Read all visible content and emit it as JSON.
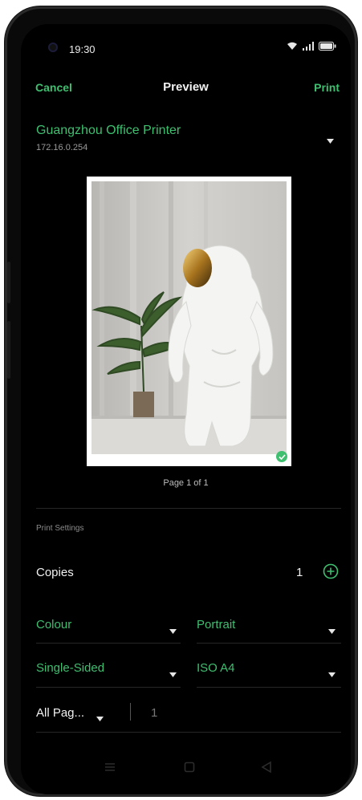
{
  "status_bar": {
    "time": "19:30"
  },
  "header": {
    "cancel_label": "Cancel",
    "title": "Preview",
    "print_label": "Print"
  },
  "printer": {
    "name": "Guangzhou Office Printer",
    "ip": "172.16.0.254"
  },
  "preview": {
    "page_label": "Page 1 of 1"
  },
  "settings": {
    "section_label": "Print Settings",
    "copies_label": "Copies",
    "copies_value": "1",
    "colour": "Colour",
    "orientation": "Portrait",
    "sides": "Single-Sided",
    "paper_size": "ISO A4",
    "pages_option": "All Pag...",
    "pages_value": "1"
  },
  "colors": {
    "accent": "#3fbf70",
    "background": "#000000",
    "text": "#f2f2f2"
  },
  "icons": [
    "camera-icon",
    "wifi-icon",
    "signal-icon",
    "battery-icon",
    "dropdown-caret-icon",
    "check-icon",
    "plus-circle-icon",
    "menu-nav-icon",
    "home-nav-icon",
    "back-nav-icon"
  ]
}
